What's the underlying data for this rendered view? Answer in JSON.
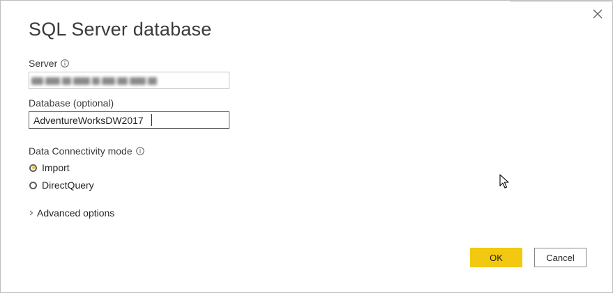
{
  "dialog": {
    "title": "SQL Server database",
    "close_icon": "close-icon"
  },
  "server": {
    "label": "Server",
    "value": "",
    "value_redacted": true
  },
  "database": {
    "label": "Database (optional)",
    "value": "AdventureWorksDW2017"
  },
  "connectivity": {
    "label": "Data Connectivity mode",
    "options": [
      {
        "label": "Import",
        "selected": true
      },
      {
        "label": "DirectQuery",
        "selected": false
      }
    ]
  },
  "advanced": {
    "label": "Advanced options",
    "expanded": false
  },
  "buttons": {
    "ok_label": "OK",
    "cancel_label": "Cancel"
  },
  "colors": {
    "accent": "#f2c811",
    "text": "#252423",
    "title": "#3b3a39",
    "border": "#c8c6c4"
  }
}
